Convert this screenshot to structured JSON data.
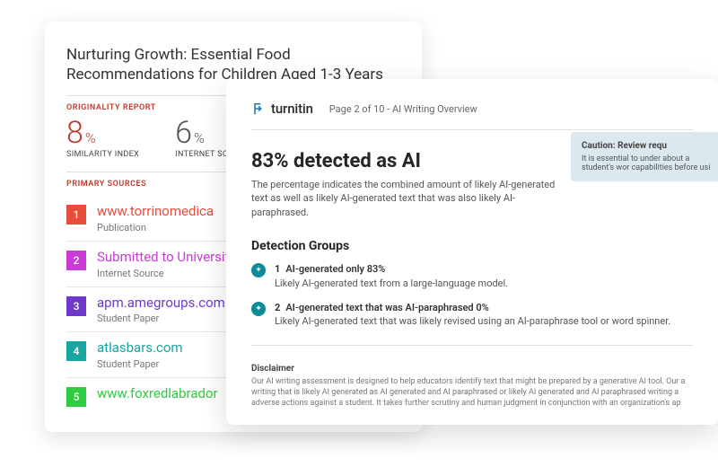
{
  "originality": {
    "title": "Nurturing Growth: Essential Food Recommendations for Children Aged 1-3 Years",
    "report_label": "ORIGINALITY REPORT",
    "similarity_value": "8",
    "similarity_unit": "%",
    "similarity_label": "SIMILARITY INDEX",
    "internet_value": "6",
    "internet_unit": "%",
    "internet_label": "INTERNET SOURCES",
    "sources_label": "PRIMARY SOURCES",
    "sources": [
      {
        "num": "1",
        "link": "www.torrinomedica",
        "type": "Publication",
        "color": "red"
      },
      {
        "num": "2",
        "link": "Submitted to University Campus (UAGC)",
        "type": "Internet Source",
        "color": "mag"
      },
      {
        "num": "3",
        "link": "apm.amegroups.com",
        "type": "Student Paper",
        "color": "pur"
      },
      {
        "num": "4",
        "link": "atlasbars.com",
        "type": "Student Paper",
        "color": "teal"
      },
      {
        "num": "5",
        "link": "www.foxredlabrador",
        "type": "",
        "color": "grn"
      }
    ]
  },
  "ai": {
    "brand": "turnitin",
    "page_label": "Page 2 of 10 - AI Writing Overview",
    "headline": "83% detected as AI",
    "sub": "The percentage indicates the combined amount of likely AI-generated text as well as likely AI-generated text that was also likely AI-paraphrased.",
    "caution_title": "Caution: Review requ",
    "caution_body": "It is essential to under about a student's wor capabilities before usi",
    "groups_title": "Detection Groups",
    "groups": [
      {
        "num": "1",
        "title": "AI-generated only  83%",
        "desc": "Likely AI-generated text from a large-language model."
      },
      {
        "num": "2",
        "title": "AI-generated text that was AI-paraphrased  0%",
        "desc": "Likely AI-generated text that was likely revised using an AI-paraphrase tool or word spinner."
      }
    ],
    "disclaimer_h": "Disclaimer",
    "disclaimer_p": "Our AI writing assessment is designed to help educators identify text that might be prepared by a generative AI tool. Our a writing that is likely AI generated as AI generated and AI paraphrased or likely AI generated and AI paraphrased writing a adverse actions against a student. It takes further scrutiny and human judgment in conjunction with an organization's ap"
  }
}
